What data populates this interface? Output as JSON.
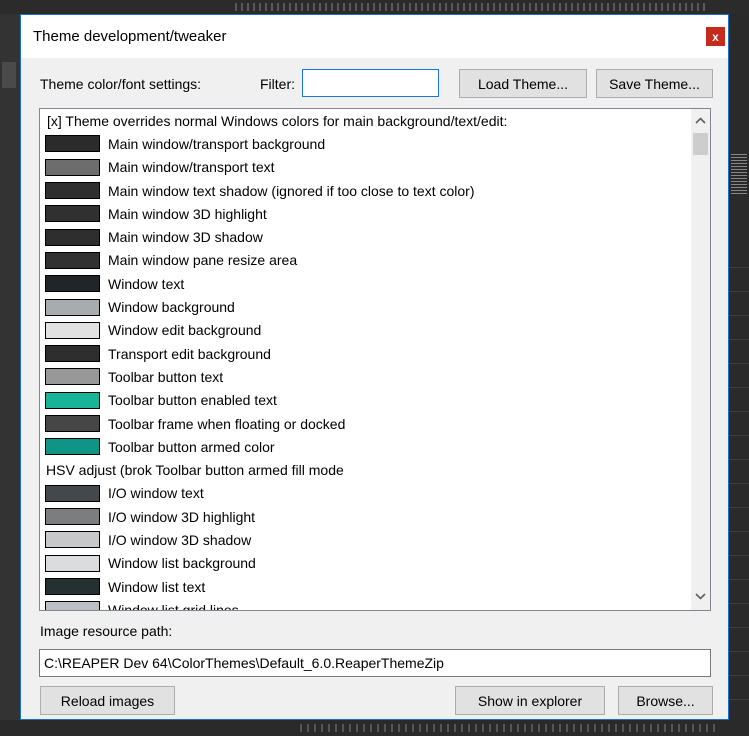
{
  "window": {
    "title": "Theme development/tweaker",
    "close_glyph": "x"
  },
  "toolbar": {
    "settings_label": "Theme color/font settings:",
    "filter_label": "Filter:",
    "filter_value": "",
    "load_label": "Load Theme...",
    "save_label": "Save Theme..."
  },
  "list": {
    "items": [
      {
        "label": "[x]  Theme overrides normal Windows colors for main background/text/edit:",
        "color": null
      },
      {
        "label": "Main window/transport background",
        "color": "#2b2b2b"
      },
      {
        "label": "Main window/transport text",
        "color": "#6d6d6d"
      },
      {
        "label": "Main window text shadow (ignored if too close to text color)",
        "color": "#2f2f2f"
      },
      {
        "label": "Main window 3D highlight",
        "color": "#303030"
      },
      {
        "label": "Main window 3D shadow",
        "color": "#2e2e2e"
      },
      {
        "label": "Main window pane resize area",
        "color": "#313131"
      },
      {
        "label": "Window text",
        "color": "#212527"
      },
      {
        "label": "Window background",
        "color": "#a9acad"
      },
      {
        "label": "Window edit background",
        "color": "#e1e1e1"
      },
      {
        "label": "Transport edit background",
        "color": "#2e2e2e"
      },
      {
        "label": "Toolbar button text",
        "color": "#989898"
      },
      {
        "label": "Toolbar button enabled text",
        "color": "#17b497"
      },
      {
        "label": "Toolbar frame when floating or docked",
        "color": "#464646"
      },
      {
        "label": "Toolbar button armed color",
        "color": "#109485"
      },
      {
        "label": "HSV adjust (brok  Toolbar button armed fill mode",
        "color": null
      },
      {
        "label": "I/O window text",
        "color": "#45484b"
      },
      {
        "label": "I/O window 3D highlight",
        "color": "#7b7d7e"
      },
      {
        "label": "I/O window 3D shadow",
        "color": "#c6c8c9"
      },
      {
        "label": "Window list background",
        "color": "#dadcdd"
      },
      {
        "label": "Window list text",
        "color": "#253031"
      },
      {
        "label": "Window list grid lines",
        "color": "#bcc0c2"
      }
    ]
  },
  "resources": {
    "path_label": "Image resource path:",
    "path_value": "C:\\REAPER Dev 64\\ColorThemes\\Default_6.0.ReaperThemeZip",
    "reload_label": "Reload images",
    "explorer_label": "Show in explorer",
    "browse_label": "Browse..."
  }
}
